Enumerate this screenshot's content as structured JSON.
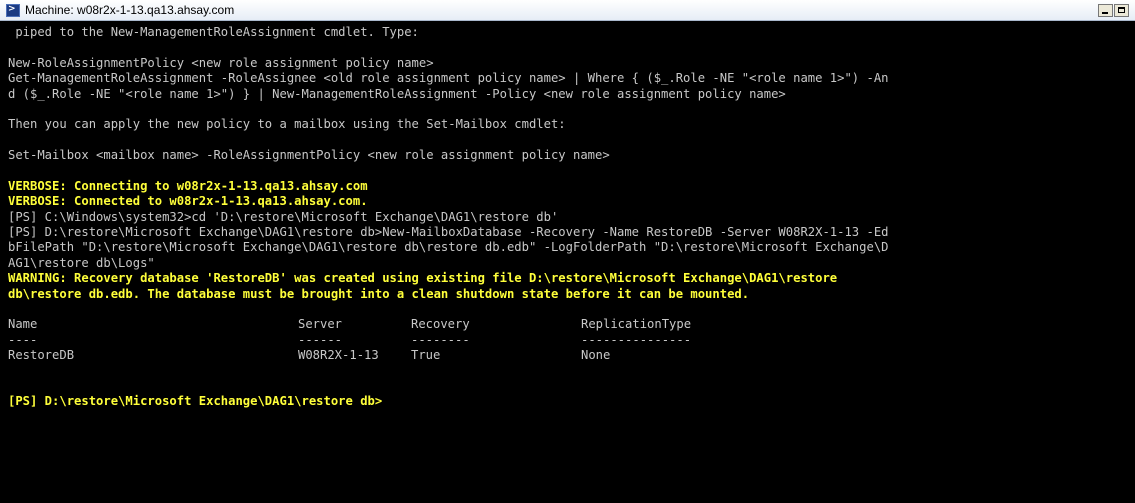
{
  "window": {
    "title": "Machine: w08r2x-1-13.qa13.ahsay.com"
  },
  "console": {
    "lines": [
      {
        "text": " piped to the New-ManagementRoleAssignment cmdlet. Type:",
        "style": "normal"
      },
      {
        "text": "",
        "style": "normal"
      },
      {
        "text": "New-RoleAssignmentPolicy <new role assignment policy name>",
        "style": "normal"
      },
      {
        "text": "Get-ManagementRoleAssignment -RoleAssignee <old role assignment policy name> | Where { ($_.Role -NE \"<role name 1>\") -An",
        "style": "normal"
      },
      {
        "text": "d ($_.Role -NE \"<role name 1>\") } | New-ManagementRoleAssignment -Policy <new role assignment policy name>",
        "style": "normal"
      },
      {
        "text": "",
        "style": "normal"
      },
      {
        "text": "Then you can apply the new policy to a mailbox using the Set-Mailbox cmdlet:",
        "style": "normal"
      },
      {
        "text": "",
        "style": "normal"
      },
      {
        "text": "Set-Mailbox <mailbox name> -RoleAssignmentPolicy <new role assignment policy name>",
        "style": "normal"
      },
      {
        "text": "",
        "style": "normal"
      },
      {
        "text": "VERBOSE: Connecting to w08r2x-1-13.qa13.ahsay.com",
        "style": "yellow"
      },
      {
        "text": "VERBOSE: Connected to w08r2x-1-13.qa13.ahsay.com.",
        "style": "yellow"
      },
      {
        "text": "[PS] C:\\Windows\\system32>cd 'D:\\restore\\Microsoft Exchange\\DAG1\\restore db'",
        "style": "normal"
      },
      {
        "text": "[PS] D:\\restore\\Microsoft Exchange\\DAG1\\restore db>New-MailboxDatabase -Recovery -Name RestoreDB -Server W08R2X-1-13 -Ed",
        "style": "normal"
      },
      {
        "text": "bFilePath \"D:\\restore\\Microsoft Exchange\\DAG1\\restore db\\restore db.edb\" -LogFolderPath \"D:\\restore\\Microsoft Exchange\\D",
        "style": "normal"
      },
      {
        "text": "AG1\\restore db\\Logs\"",
        "style": "normal"
      },
      {
        "text": "WARNING: Recovery database 'RestoreDB' was created using existing file D:\\restore\\Microsoft Exchange\\DAG1\\restore",
        "style": "yellow"
      },
      {
        "text": "db\\restore db.edb. The database must be brought into a clean shutdown state before it can be mounted.",
        "style": "yellow"
      },
      {
        "text": "",
        "style": "normal"
      }
    ],
    "table": {
      "headers": [
        "Name",
        "Server",
        "Recovery",
        "ReplicationType"
      ],
      "underlines": [
        "----",
        "------",
        "--------",
        "---------------"
      ],
      "rows": [
        [
          "RestoreDB",
          "W08R2X-1-13",
          "True",
          "None"
        ]
      ]
    },
    "prompt": "[PS] D:\\restore\\Microsoft Exchange\\DAG1\\restore db>"
  }
}
